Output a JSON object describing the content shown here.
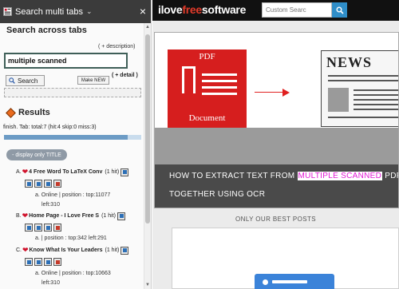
{
  "panel": {
    "header_title": "Search multi tabs",
    "heading": "Search across tabs",
    "description_link": "( + description)",
    "search_value": "multiple scanned",
    "search_button": "Search",
    "make_new_button": "Make NEW",
    "detail_link": "( + detail )",
    "results_heading": "Results",
    "status_text": "finish. Tab: total:7 (hit:4 skip:0 miss:3)",
    "progress_fraction": 0.9,
    "display_only_title": "- display only TITLE",
    "results": [
      {
        "marker": "A.",
        "title": "4 Free Word To LaTeX Conv",
        "hits": "(1 hit)",
        "meta1": "a. Online | position : top:11077",
        "meta2": "left:310"
      },
      {
        "marker": "B.",
        "title": "Home Page - I Love Free S",
        "hits": "(1 hit)",
        "meta1": "a. | position : top:342 left:291"
      },
      {
        "marker": "C.",
        "title": "Know What Is Your Leaders",
        "hits": "(1 hit)",
        "meta1": "a. Online | position : top:10663",
        "meta2": "left:310"
      }
    ]
  },
  "site": {
    "logo_prefix": "ilove",
    "logo_accent": "free",
    "logo_suffix": "software",
    "search_placeholder": "Custom Searc",
    "hero_caption_line1_before": "HOW TO EXTRACT TEXT FROM",
    "hero_caption_highlight": "MULTIPLE SCANNED",
    "hero_caption_line1_after": "PDF",
    "hero_caption_line2": "TOGETHER USING OCR",
    "pdf_label_top": "PDF",
    "pdf_label_bottom": "Document",
    "news_word": "NEWS",
    "best_posts": "ONLY OUR BEST POSTS"
  },
  "colors": {
    "highlight_text": "#e21ad4",
    "pdf_red": "#d61e1e",
    "accent_blue": "#2f8ec9",
    "logo_red": "#e13a2a"
  }
}
